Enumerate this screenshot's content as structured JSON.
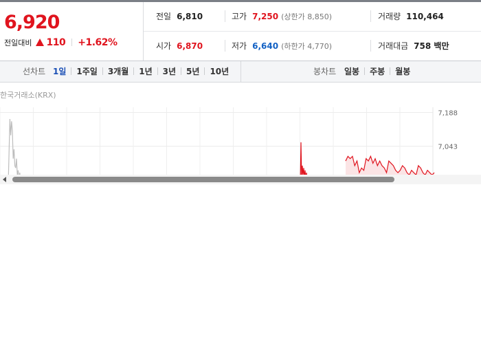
{
  "summary": {
    "current_price": "6,920",
    "change_label": "전일대비",
    "change_direction_icon": "up-triangle-icon",
    "change_amount": "110",
    "change_percent": "+1.62%",
    "stats": {
      "prev_close": {
        "label": "전일",
        "value": "6,810"
      },
      "high": {
        "label": "고가",
        "value": "7,250",
        "sub": "(상한가 8,850)"
      },
      "volume": {
        "label": "거래량",
        "value": "110,464"
      },
      "open": {
        "label": "시가",
        "value": "6,870"
      },
      "low": {
        "label": "저가",
        "value": "6,640",
        "sub": "(하한가 4,770)"
      },
      "turnover": {
        "label": "거래대금",
        "value": "758 백만"
      }
    },
    "colors": {
      "up": "#e0141e",
      "down": "#1261c4"
    }
  },
  "period_bar": {
    "line_chart_label": "선차트",
    "line_periods": [
      "1일",
      "1주일",
      "3개월",
      "1년",
      "3년",
      "5년",
      "10년"
    ],
    "active_period": "1일",
    "candle_chart_label": "봉차트",
    "candle_periods": [
      "일봉",
      "주봉",
      "월봉"
    ]
  },
  "chart": {
    "source": "한국거래소(KRX)"
  },
  "chart_data": {
    "type": "line",
    "title": "",
    "xlabel": "",
    "ylabel": "",
    "y_ticks": [
      7043,
      7188
    ],
    "y_tick_labels": [
      "7,043",
      "7,188"
    ],
    "ylim": [
      6880,
      7210
    ],
    "grid": true,
    "series": [
      {
        "color": "#bdbdbd",
        "x": [
          0,
          1,
          2,
          3,
          4,
          5,
          6,
          7,
          8,
          9,
          10,
          11,
          12,
          13,
          14,
          15
        ],
        "values": [
          6880,
          7020,
          7160,
          7090,
          7150,
          7110,
          6990,
          7030,
          6960,
          6950,
          6990,
          6920,
          6940,
          6900,
          6930,
          6880
        ]
      },
      {
        "color": "#e0141e",
        "x": [
          0,
          1,
          2,
          3,
          4,
          5,
          6,
          7,
          8,
          9,
          10,
          11,
          12,
          13,
          14,
          15,
          16,
          17,
          18,
          19,
          20,
          21,
          22,
          23,
          24,
          25,
          26,
          27,
          28,
          29,
          30,
          31,
          32,
          33,
          34,
          35,
          36,
          37,
          38,
          39,
          40,
          41,
          42,
          43,
          44,
          45,
          46,
          47,
          48,
          49,
          50,
          51,
          52,
          53,
          54,
          55,
          56,
          57,
          58,
          59
        ],
        "values": [
          6880,
          7060,
          6900,
          6960,
          6920,
          6950,
          6910,
          6940,
          6900,
          6930,
          6910,
          6890,
          6880,
          6890,
          6900,
          6880,
          6890,
          6900,
          6880,
          6890,
          6980,
          7000,
          6990,
          7000,
          6960,
          6980,
          6930,
          6950,
          6940,
          6990,
          6980,
          7000,
          6970,
          6990,
          6960,
          6980,
          6960,
          6950,
          6930,
          6980,
          6970,
          6960,
          6940,
          6930,
          6940,
          6960,
          6950,
          6930,
          6920,
          6940,
          6930,
          6920,
          6960,
          6950,
          6930,
          6920,
          6940,
          6930,
          6920,
          6930
        ]
      }
    ]
  }
}
